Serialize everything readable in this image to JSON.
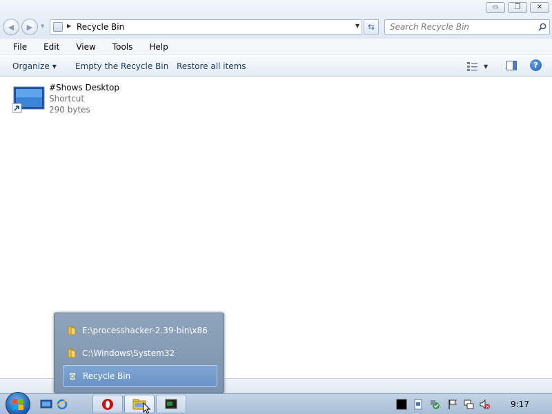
{
  "window": {
    "minimize_glyph": "▭",
    "maximize_glyph": "❐",
    "close_glyph": "✕"
  },
  "address": {
    "location": "Recycle Bin",
    "icon": "recycle-bin-icon"
  },
  "search": {
    "placeholder": "Search Recycle Bin",
    "icon": "search-icon"
  },
  "menu": {
    "file": "File",
    "edit": "Edit",
    "view": "View",
    "tools": "Tools",
    "help": "Help"
  },
  "commands": {
    "organize": "Organize",
    "empty": "Empty the Recycle Bin",
    "restore": "Restore all items"
  },
  "file": {
    "name": "#Shows Desktop",
    "type": "Shortcut",
    "size": "290 bytes"
  },
  "jumplist": {
    "items": [
      {
        "label": "E:\\processhacker-2.39-bin\\x86",
        "icon": "folder-icon"
      },
      {
        "label": "C:\\Windows\\System32",
        "icon": "folder-icon"
      },
      {
        "label": "Recycle Bin",
        "icon": "recycle-bin-icon"
      }
    ],
    "selected_index": 2
  },
  "taskbar": {
    "clock": "9:17"
  },
  "colors": {
    "accent": "#1e395b",
    "jumplist_bg": "#8fa3bc",
    "jumplist_selected": "#6a93c6",
    "taskbar": "#b6c9de"
  }
}
